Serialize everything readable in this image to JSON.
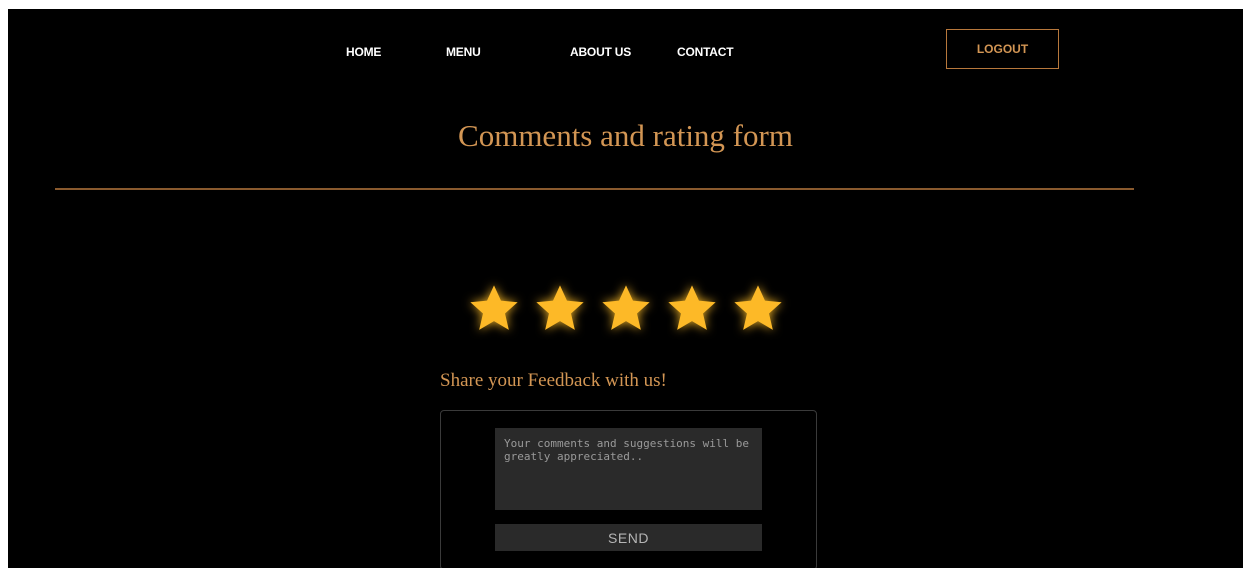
{
  "nav": {
    "home": "HOME",
    "menu": "MENU",
    "about": "ABOUT US",
    "contact": "CONTACT",
    "logout": "LOGOUT"
  },
  "page": {
    "title": "Comments and rating form"
  },
  "rating": {
    "value": 5,
    "max": 5,
    "star_icon": "star-icon",
    "star_color": "#FDB927"
  },
  "feedback": {
    "heading": "Share your Feedback with us!",
    "placeholder": "Your comments and suggestions will be greatly appreciated..",
    "send_label": "SEND"
  },
  "colors": {
    "accent": "#D39654",
    "background": "#000000",
    "input_bg": "#2A2A2A"
  }
}
